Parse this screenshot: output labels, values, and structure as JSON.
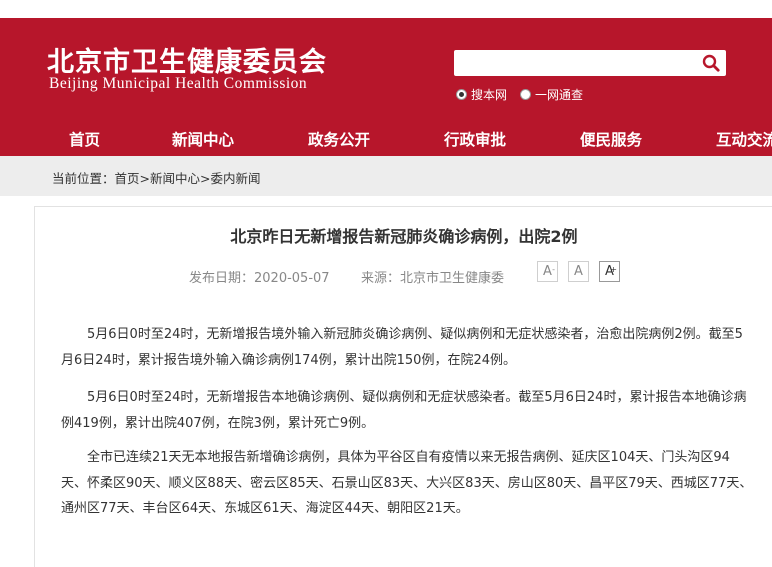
{
  "header": {
    "logo_cn": "北京市卫生健康委员会",
    "logo_en": "Beijing Municipal Health Commission",
    "search": {
      "placeholder": "",
      "value": ""
    },
    "scope_options": [
      {
        "label": "搜本网",
        "checked": true
      },
      {
        "label": "一网通查",
        "checked": false
      }
    ],
    "brand_color": "#b7162b"
  },
  "nav": {
    "items": [
      {
        "label": "首页"
      },
      {
        "label": "新闻中心"
      },
      {
        "label": "政务公开"
      },
      {
        "label": "行政审批"
      },
      {
        "label": "便民服务"
      },
      {
        "label": "互动交流"
      }
    ]
  },
  "breadcrumb": {
    "prefix": "当前位置：",
    "items": [
      "首页",
      "新闻中心",
      "委内新闻"
    ],
    "separator": ">"
  },
  "article": {
    "title": "北京昨日无新增报告新冠肺炎确诊病例，出院2例",
    "date": "发布日期：2020-05-07",
    "source": "来源：北京市卫生健康委",
    "font_buttons": [
      {
        "label": "A",
        "sup": "-"
      },
      {
        "label": "A",
        "sup": ""
      },
      {
        "label": "A",
        "sup": "+"
      }
    ],
    "paragraphs": [
      "5月6日0时至24时，无新增报告境外输入新冠肺炎确诊病例、疑似病例和无症状感染者，治愈出院病例2例。截至5月6日24时，累计报告境外输入确诊病例174例，累计出院150例，在院24例。",
      "5月6日0时至24时，无新增报告本地确诊病例、疑似病例和无症状感染者。截至5月6日24时，累计报告本地确诊病例419例，累计出院407例，在院3例，累计死亡9例。",
      "全市已连续21天无本地报告新增确诊病例，具体为平谷区自有疫情以来无报告病例、延庆区104天、门头沟区94天、怀柔区90天、顺义区88天、密云区85天、石景山区83天、大兴区83天、房山区80天、昌平区79天、西城区77天、通州区77天、丰台区64天、东城区61天、海淀区44天、朝阳区21天。"
    ]
  }
}
